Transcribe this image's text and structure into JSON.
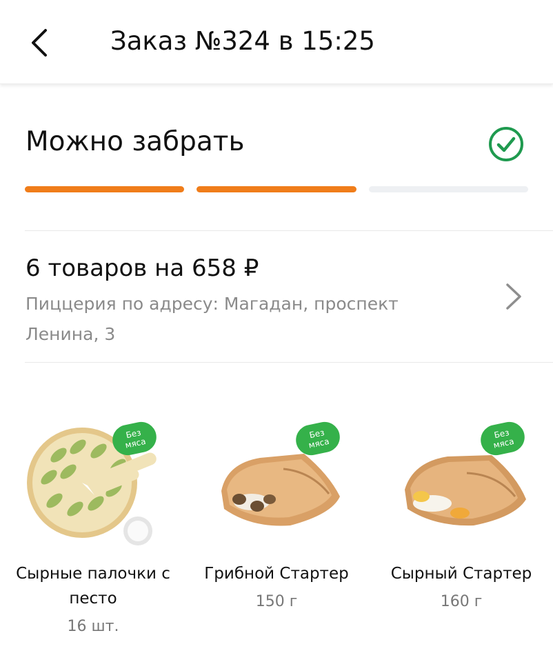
{
  "header": {
    "title": "Заказ №324 в 15:25"
  },
  "status": {
    "label": "Можно забрать",
    "progress_steps_completed": 2,
    "progress_steps_total": 3
  },
  "order_summary": {
    "title": "6 товаров на 658 ₽",
    "address": "Пиццерия по адресу: Магадан, проспект Ленина, 3"
  },
  "products": [
    {
      "name": "Сырные палочки с песто",
      "weight": "16 шт.",
      "badge": [
        "Без",
        "мяса"
      ]
    },
    {
      "name": "Грибной Стартер",
      "weight": "150 г",
      "badge": [
        "Без",
        "мяса"
      ]
    },
    {
      "name": "Сырный Стартер",
      "weight": "160 г",
      "badge": [
        "Без",
        "мяса"
      ]
    }
  ],
  "colors": {
    "accent": "#f07d1a",
    "progress_inactive": "#eef0f3",
    "check_green": "#1f9a4f",
    "badge_green": "#35b14a",
    "secondary_text": "#8a8a8a"
  },
  "icons": {
    "back": "chevron-left-icon",
    "status": "check-circle-icon",
    "summary_arrow": "chevron-right-icon"
  }
}
